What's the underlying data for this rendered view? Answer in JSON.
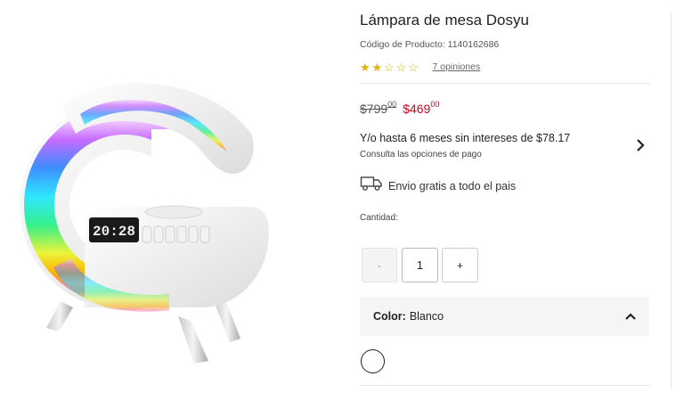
{
  "product": {
    "title": "Lámpara de mesa Dosyu",
    "code_label": "Código de Producto: 1140162686",
    "rating": 2,
    "rating_max": 5,
    "reviews_label": "7 opiniones",
    "colors": {
      "star": "#e0b400",
      "sale": "#d0021b"
    }
  },
  "price": {
    "old_main": "$799",
    "old_cents": "00",
    "new_main": "$469",
    "new_cents": "00"
  },
  "installments": {
    "text": "Y/o hasta 6 meses sin intereses de $78.17",
    "sub": "Consulta las opciones de pago",
    "icon": "chevron-right-icon"
  },
  "shipping": {
    "text": "Envio gratis a todo el pais",
    "icon": "truck-icon"
  },
  "quantity": {
    "label": "Cantidad:",
    "minus": "-",
    "value": "1",
    "plus": "+"
  },
  "color": {
    "label": "Color:",
    "value": "Blanco",
    "icon": "chevron-up-icon",
    "swatch_color": "#ffffff"
  },
  "image": {
    "subject": "G-shaped RGB lamp with digital clock",
    "clock_text": "20:28"
  }
}
